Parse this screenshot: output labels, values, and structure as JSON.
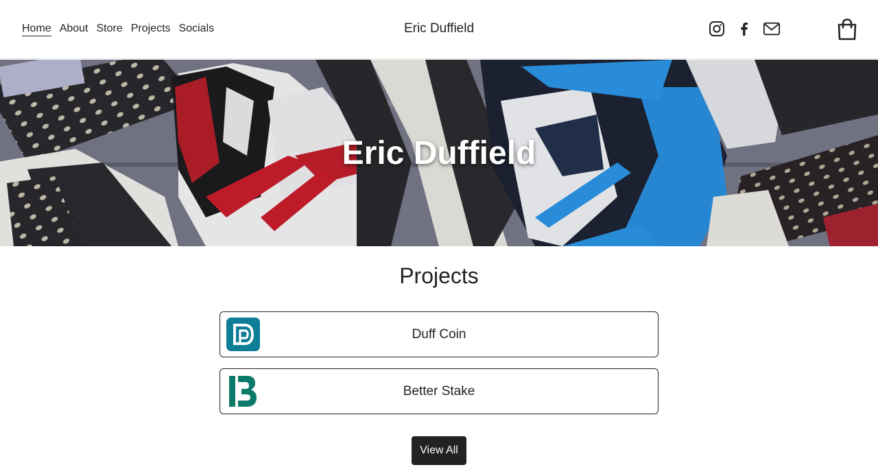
{
  "nav": {
    "items": [
      {
        "label": "Home",
        "active": true
      },
      {
        "label": "About"
      },
      {
        "label": "Store"
      },
      {
        "label": "Projects"
      },
      {
        "label": "Socials"
      }
    ]
  },
  "header": {
    "site_title": "Eric Duffield",
    "social_icons": [
      "instagram-icon",
      "facebook-icon",
      "mail-icon"
    ],
    "cart_icon": "shopping-bag-icon"
  },
  "hero": {
    "title": "Eric Duffield",
    "background": "photo of sneakers (red/black/white and blue/navy/white high-tops)"
  },
  "projects": {
    "heading": "Projects",
    "items": [
      {
        "name": "Duff Coin",
        "logo_color": "#0e7d96"
      },
      {
        "name": "Better Stake",
        "logo_color": "#0b7a6a"
      }
    ],
    "view_all_label": "View All"
  },
  "colors": {
    "text": "#222222",
    "button_bg": "#222222",
    "button_text": "#ffffff"
  }
}
